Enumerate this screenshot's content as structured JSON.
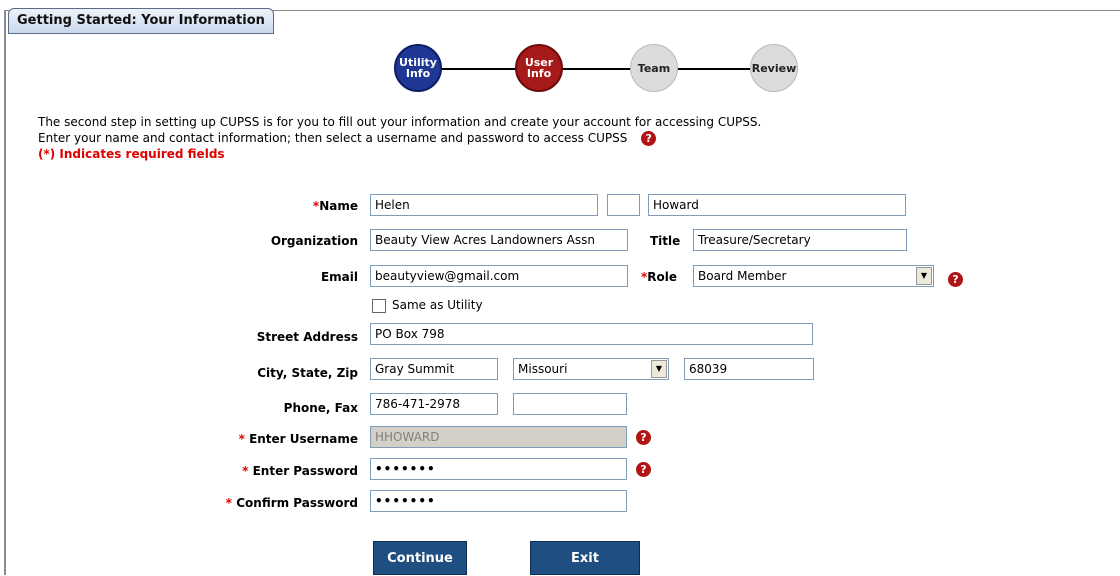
{
  "tab_title": "Getting Started: Your Information",
  "steps": [
    {
      "label_line1": "Utility",
      "label_line2": "Info"
    },
    {
      "label_line1": "User",
      "label_line2": "Info"
    },
    {
      "label_line1": "Team",
      "label_line2": ""
    },
    {
      "label_line1": "Review",
      "label_line2": ""
    }
  ],
  "intro": {
    "line1": "The second step in setting up CUPSS is for you to fill out your information and create your account for accessing CUPSS.",
    "line2": "Enter your name and contact information; then select a username and password to access CUPSS",
    "required_note": "(*) Indicates required fields"
  },
  "help_glyph": "?",
  "required_star": "*",
  "form": {
    "name_label": "Name",
    "first_name": "Helen",
    "middle_initial": "",
    "last_name": "Howard",
    "organization_label": "Organization",
    "organization": "Beauty View Acres Landowners Assn",
    "title_label": "Title",
    "title": "Treasure/Secretary",
    "email_label": "Email",
    "email": "beautyview@gmail.com",
    "role_label": "Role",
    "role": "Board Member",
    "same_as_utility_label": "Same as Utility",
    "street_label": "Street Address",
    "street": "PO Box 798",
    "city_label": "City, State, Zip",
    "city": "Gray Summit",
    "state": "Missouri",
    "zip": "68039",
    "phone_label": "Phone, Fax",
    "phone": "786-471-2978",
    "fax": "",
    "username_label": "Enter Username",
    "username": "HHOWARD",
    "password_label": "Enter Password",
    "password_mask": "•••••••",
    "confirm_label": "Confirm Password",
    "confirm_mask": "•••••••"
  },
  "buttons": {
    "continue": "Continue",
    "exit": "Exit"
  },
  "colors": {
    "step_active": "#1f3795",
    "step_current": "#a71a1a",
    "required": "#e00000",
    "button": "#1f4f80"
  }
}
